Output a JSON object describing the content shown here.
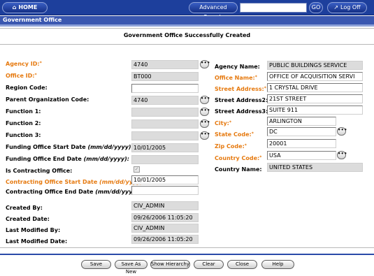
{
  "topbar": {
    "home_label": "HOME",
    "advanced_search_label": "Advanced Search",
    "search_value": "",
    "go_label": "GO",
    "logoff_label": "Log Off"
  },
  "section": {
    "title": "Government Office"
  },
  "message": "Government Office Successfully Created",
  "left": {
    "agency_id": {
      "label": "Agency ID:",
      "value": "4740"
    },
    "office_id": {
      "label": "Office ID:",
      "value": "BT000"
    },
    "region_code": {
      "label": "Region Code:",
      "value": ""
    },
    "parent_org_code": {
      "label": "Parent Organization Code:",
      "value": "4740"
    },
    "function1": {
      "label": "Function 1:",
      "value": ""
    },
    "function2": {
      "label": "Function 2:",
      "value": ""
    },
    "function3": {
      "label": "Function 3:",
      "value": ""
    },
    "funding_start": {
      "label": "Funding Office Start Date",
      "hint": "(mm/dd/yyyy):",
      "value": "10/01/2005"
    },
    "funding_end": {
      "label": "Funding Office End Date",
      "hint": "(mm/dd/yyyy):",
      "value": ""
    },
    "is_contracting": {
      "label": "Is Contracting Office:",
      "checked_glyph": "✓"
    },
    "contracting_start": {
      "label": "Contracting Office Start Date",
      "hint": "(mm/dd/yyyy):",
      "value": "10/01/2005"
    },
    "contracting_end": {
      "label": "Contracting Office End Date",
      "hint": "(mm/dd/yyyy):",
      "value": ""
    },
    "created_by": {
      "label": "Created By:",
      "value": "CIV_ADMIN"
    },
    "created_date": {
      "label": "Created Date:",
      "value": "09/26/2006 11:05:20"
    },
    "last_modified_by": {
      "label": "Last Modified By:",
      "value": "CIV_ADMIN"
    },
    "last_modified_date": {
      "label": "Last Modified Date:",
      "value": "09/26/2006 11:05:20"
    }
  },
  "right": {
    "agency_name": {
      "label": "Agency Name:",
      "value": "PUBLIC BUILDINGS SERVICE"
    },
    "office_name": {
      "label": "Office Name:",
      "value": "OFFICE OF ACQUISITION SERVI"
    },
    "street1": {
      "label": "Street Address:",
      "value": "1 CRYSTAL DRIVE"
    },
    "street2": {
      "label": "Street Address2:",
      "value": "21ST STREET"
    },
    "street3": {
      "label": "Street Address3:",
      "value": "SUITE 911"
    },
    "city": {
      "label": "City:",
      "value": "ARLINGTON"
    },
    "state": {
      "label": "State Code:",
      "value": "DC"
    },
    "zip": {
      "label": "Zip Code:",
      "value": "20001"
    },
    "country_code": {
      "label": "Country Code:",
      "value": "USA"
    },
    "country_name": {
      "label": "Country Name:",
      "value": "UNITED STATES"
    }
  },
  "lookup_glyph": "•••",
  "required_marker": "*",
  "actions": {
    "save": "Save",
    "save_as_new": "Save As New",
    "show_hierarchy": "Show Hierarchy",
    "clear": "Clear",
    "close": "Close",
    "help": "Help"
  },
  "colors": {
    "topbar": "#1d3f9c",
    "section": "#3a57b0",
    "required_label": "#e67a10",
    "readonly_field": "#dcdcdc"
  }
}
